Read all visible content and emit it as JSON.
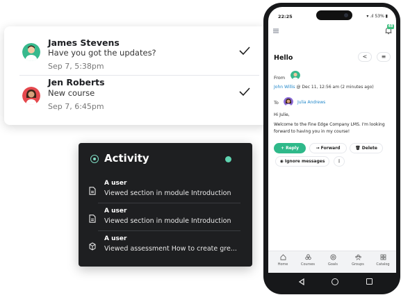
{
  "messages": [
    {
      "name": "James Stevens",
      "text": "Have you got the updates?",
      "time": "Sep 7, 5:38pm",
      "avatar_icon": "avatar-male-icon"
    },
    {
      "name": "Jen Roberts",
      "text": "New course",
      "time": "Sep 7, 6:45pm",
      "avatar_icon": "avatar-female-icon"
    }
  ],
  "activity": {
    "title": "Activity",
    "items": [
      {
        "user": "A user",
        "description": "Viewed section in module Introduction",
        "icon": "document-icon"
      },
      {
        "user": "A user",
        "description": "Viewed section in module Introduction",
        "icon": "document-icon"
      },
      {
        "user": "A user",
        "description": "Viewed assessment How to create gre...",
        "icon": "cube-icon"
      }
    ]
  },
  "phone": {
    "status": {
      "time": "22:25",
      "right": "▾ .ıl 53% ▮"
    },
    "notification_badge": "48",
    "header": {
      "title": "Hello",
      "prev_label": "<",
      "menu_label": "≡"
    },
    "message": {
      "from_label": "From",
      "sender": "John Willis",
      "sent_at": " @ Dec 11, 12:56 am (2 minutes ago)",
      "to_label": "To",
      "recipient": "Julia Andrews",
      "greeting": "Hi Julie,",
      "body": "Welcome to the Fine Edge Company LMS. I'm looking forward to having you in my course!"
    },
    "actions": {
      "reply": "+ Reply",
      "forward": "→ Forward",
      "delete": "Delete",
      "ignore": "Ignore messages",
      "more": "⋮"
    },
    "tabs": [
      {
        "label": "Home",
        "icon": "home-icon"
      },
      {
        "label": "Courses",
        "icon": "courses-icon"
      },
      {
        "label": "Goals",
        "icon": "goals-icon"
      },
      {
        "label": "Groups",
        "icon": "groups-icon"
      },
      {
        "label": "Catalog",
        "icon": "catalog-icon"
      }
    ]
  },
  "colors": {
    "accent": "#2fb98a",
    "link": "#1f86c9",
    "dark_panel": "#1e1f21"
  }
}
